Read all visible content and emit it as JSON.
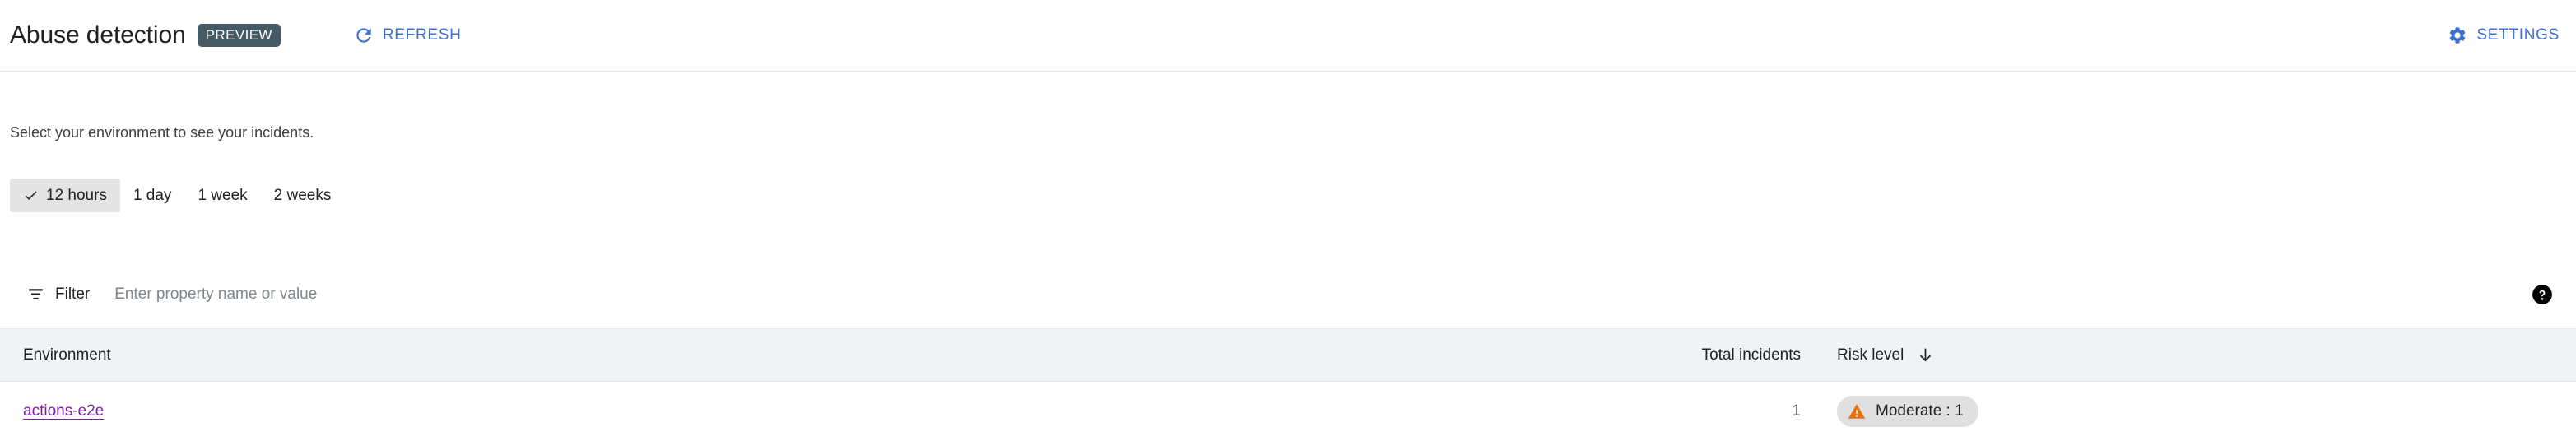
{
  "header": {
    "title": "Abuse detection",
    "badge": "PREVIEW",
    "refresh_label": "REFRESH",
    "refresh_icon": "refresh-icon",
    "settings_label": "SETTINGS",
    "settings_icon": "gear-icon",
    "accent_color": "#3c6fd1",
    "badge_color": "#455a64"
  },
  "body": {
    "intro": "Select your environment to see your incidents."
  },
  "time_range": {
    "selected": "12 hours",
    "check_icon": "check-icon",
    "options": [
      {
        "label": "12 hours",
        "selected": true
      },
      {
        "label": "1 day",
        "selected": false
      },
      {
        "label": "1 week",
        "selected": false
      },
      {
        "label": "2 weeks",
        "selected": false
      }
    ]
  },
  "filter": {
    "icon": "filter-icon",
    "label": "Filter",
    "placeholder": "Enter property name or value",
    "value": "",
    "help_icon": "help-icon"
  },
  "table": {
    "columns": [
      {
        "label": "Environment",
        "align": "left"
      },
      {
        "label": "Total incidents",
        "align": "right"
      },
      {
        "label": "Risk level",
        "align": "left",
        "sorted": true,
        "sort_direction": "desc",
        "sort_icon": "arrow-down-icon"
      }
    ],
    "rows": [
      {
        "environment": "actions-e2e",
        "total_incidents": "1",
        "risk_level": "Moderate : 1",
        "risk_icon": "warning-triangle-icon",
        "risk_chip_bg": "#e0e0e0",
        "risk_icon_color": "#e8710a",
        "environment_link_color": "#7b1fa2"
      }
    ]
  }
}
